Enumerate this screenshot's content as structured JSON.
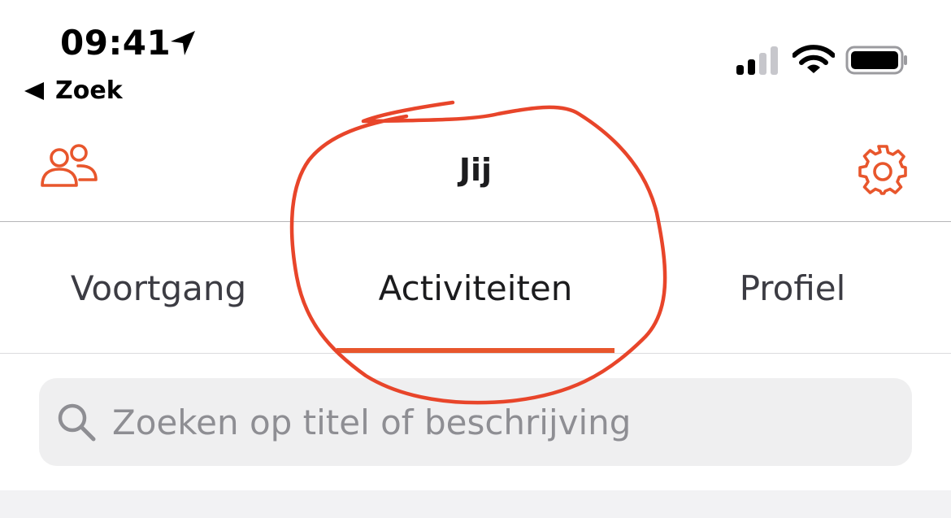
{
  "status_bar": {
    "time": "09:41",
    "location_icon": "location-arrow-icon",
    "signal_icon": "cellular-signal-icon",
    "wifi_icon": "wifi-icon",
    "battery_icon": "battery-icon"
  },
  "back_link": {
    "icon": "back-triangle-icon",
    "label": "Zoek"
  },
  "header": {
    "title": "Jij",
    "left_icon": "people-icon",
    "right_icon": "gear-icon"
  },
  "tabs": [
    {
      "label": "Voortgang",
      "selected": false
    },
    {
      "label": "Activiteiten",
      "selected": true
    },
    {
      "label": "Profiel",
      "selected": false
    }
  ],
  "search": {
    "icon": "search-icon",
    "placeholder": "Zoeken op titel of beschrijving"
  },
  "colors": {
    "accent": "#e8562c",
    "annotation": "#e8452a",
    "text_primary": "#1c1c1e",
    "text_secondary": "#3c3c43",
    "placeholder": "#8e8e93",
    "search_background": "#efeff0"
  },
  "annotation": {
    "type": "hand-drawn-circle",
    "target": "tab-activities"
  }
}
